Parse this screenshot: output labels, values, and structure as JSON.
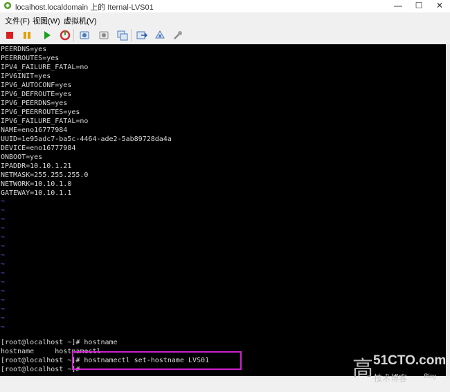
{
  "window": {
    "title": "localhost.localdomain 上的 Iternal-LVS01",
    "minimize": "—",
    "maximize": "☐",
    "close": "✕"
  },
  "menu": [
    {
      "label": "文件(F)"
    },
    {
      "label": "视图(W)"
    },
    {
      "label": "虚拟机(V)"
    }
  ],
  "toolbar": [
    {
      "name": "stop-icon",
      "color": "#d92020"
    },
    {
      "name": "pause-icon",
      "color": "#e0a000"
    },
    {
      "name": "play-icon",
      "color": "#20a020"
    },
    {
      "name": "reset-icon",
      "color": "#d03030"
    },
    {
      "name": "snapshot-icon",
      "color": "#4a7ab8"
    },
    {
      "name": "revert-snapshot-icon",
      "color": "#8a8a8a"
    },
    {
      "name": "manage-snapshots-icon",
      "color": "#4a7ab8"
    },
    {
      "name": "send-keys-icon",
      "color": "#4a7ab8"
    },
    {
      "name": "settings-icon",
      "color": "#4a7ab8"
    },
    {
      "name": "tools-icon",
      "color": "#8a8a8a"
    }
  ],
  "console": {
    "lines": [
      "PEERDNS=yes",
      "PEERROUTES=yes",
      "IPV4_FAILURE_FATAL=no",
      "IPV6INIT=yes",
      "IPV6_AUTOCONF=yes",
      "IPV6_DEFROUTE=yes",
      "IPV6_PEERDNS=yes",
      "IPV6_PEERROUTES=yes",
      "IPV6_FAILURE_FATAL=no",
      "NAME=eno16777984",
      "UUID=1e95adc7-ba5c-4464-ade2-5ab89728da4a",
      "DEVICE=eno16777984",
      "ONBOOT=yes",
      "IPADDR=10.10.1.21",
      "NETMASK=255.255.255.0",
      "NETWORK=10.10.1.0",
      "GATEWAY=10.10.1.1"
    ],
    "tilde": "~",
    "tilde_count": 15,
    "commands": [
      "[root@localhost ~]# hostname",
      "hostname     hostnamectl",
      "[root@localhost ~]# hostnamectl set-hostname LVS01",
      "[root@localhost ~]#"
    ]
  },
  "watermark": {
    "glyph": "高",
    "logo": "51CTO.com",
    "subtitle": "技术博客",
    "blog": "Blog"
  }
}
